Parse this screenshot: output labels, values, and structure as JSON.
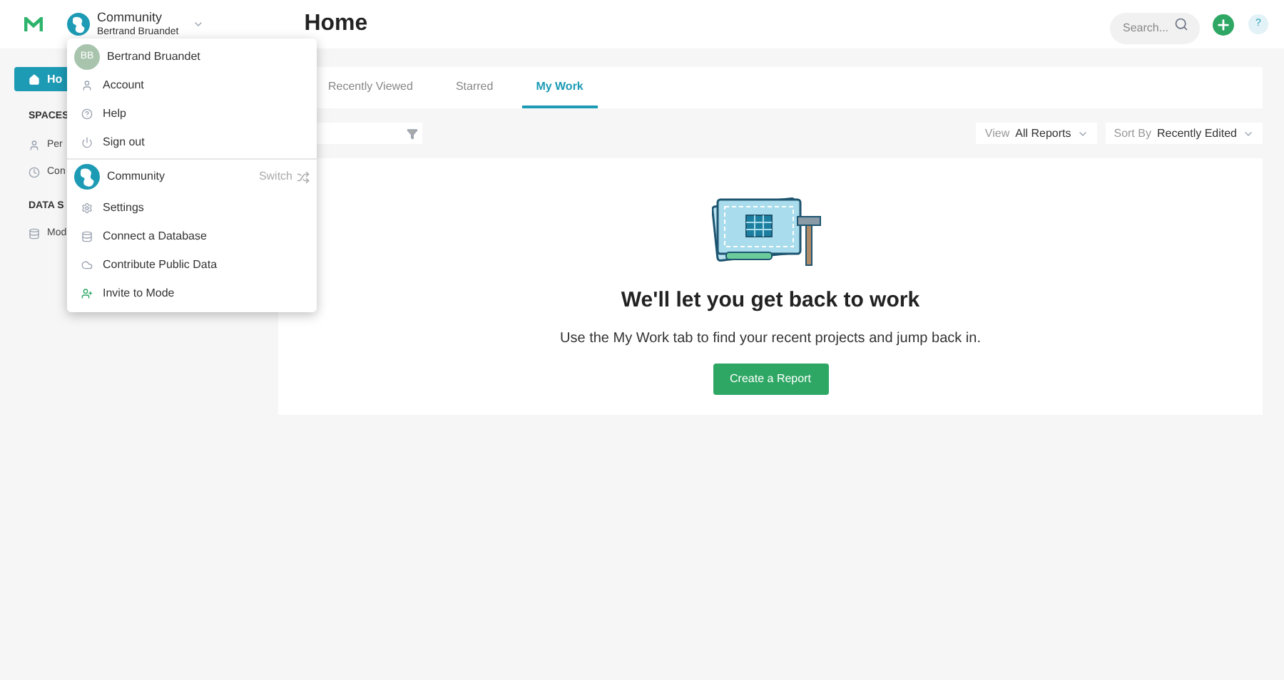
{
  "header": {
    "workspace": "Community",
    "user": "Bertrand Bruandet",
    "title": "Home",
    "search": {
      "placeholder": "Search..."
    },
    "help": "?"
  },
  "sidebar": {
    "home": "Ho",
    "sections": [
      {
        "title": "SPACES",
        "items": [
          {
            "kind": "person",
            "label": "Per"
          },
          {
            "kind": "clock",
            "label": "Con"
          }
        ]
      },
      {
        "title": "DATA S",
        "items": [
          {
            "kind": "database",
            "label": "Mod"
          }
        ]
      }
    ]
  },
  "menu": {
    "user": {
      "initials": "BB",
      "name": "Bertrand Bruandet"
    },
    "user_items": [
      {
        "kind": "person",
        "label": "Account"
      },
      {
        "kind": "help",
        "label": "Help"
      },
      {
        "kind": "power",
        "label": "Sign out"
      }
    ],
    "workspace": {
      "name": "Community",
      "action": "Switch"
    },
    "workspace_items": [
      {
        "kind": "gear",
        "label": "Settings"
      },
      {
        "kind": "database",
        "label": "Connect a Database"
      },
      {
        "kind": "cloud",
        "label": "Contribute Public Data"
      },
      {
        "kind": "invite",
        "label": "Invite to Mode"
      }
    ]
  },
  "tabs": [
    {
      "label": "Recently Viewed",
      "selected": false
    },
    {
      "label": "Starred",
      "selected": false
    },
    {
      "label": "My Work",
      "selected": true
    }
  ],
  "filters": {
    "view": {
      "label": "View",
      "value": "All Reports"
    },
    "sort": {
      "label": "Sort By",
      "value": "Recently Edited"
    }
  },
  "empty_state": {
    "heading": "We'll let you get back to work",
    "text": "Use the My Work tab to find your recent projects and jump back in.",
    "button": "Create a Report"
  }
}
